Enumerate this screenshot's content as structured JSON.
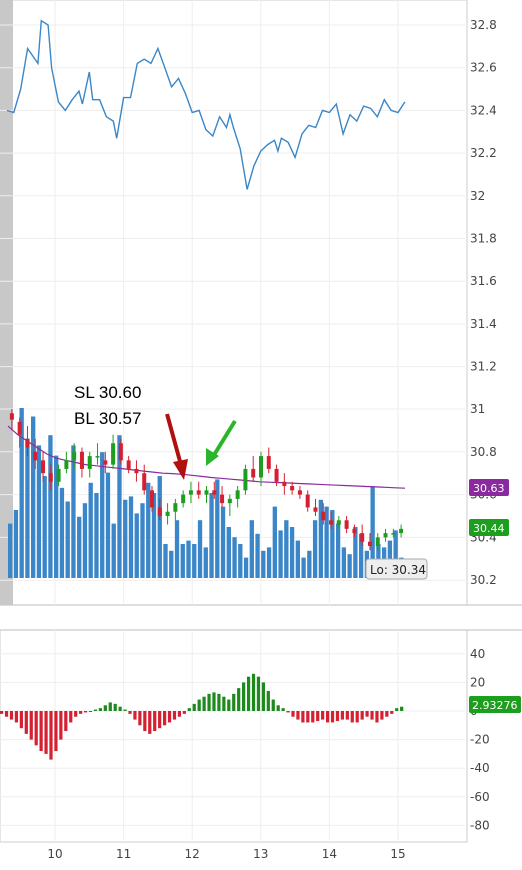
{
  "chart_data": [
    {
      "type": "line",
      "panel": "upper",
      "title": "",
      "xlabel": "",
      "ylabel": "",
      "ylim": [
        32.0,
        32.9
      ],
      "grid": true,
      "color": "#3a86c8",
      "x_ticks": [
        "10",
        "11",
        "12",
        "13",
        "14",
        "15"
      ],
      "y_ticks": [
        "32.8",
        "32.6",
        "32.4",
        "32.2",
        "32"
      ],
      "series": [
        {
          "x": [
            9.3,
            9.4,
            9.5,
            9.6,
            9.75,
            9.8,
            9.9,
            9.95,
            10.05,
            10.15,
            10.25,
            10.35,
            10.4,
            10.5,
            10.55,
            10.65,
            10.75,
            10.85,
            10.9,
            11.0,
            11.1,
            11.2,
            11.3,
            11.4,
            11.5,
            11.6,
            11.7,
            11.8,
            11.9,
            12.0,
            12.1,
            12.2,
            12.3,
            12.4,
            12.5,
            12.55,
            12.6,
            12.7,
            12.8,
            12.9,
            13.0,
            13.1,
            13.2,
            13.25,
            13.3,
            13.4,
            13.5,
            13.6,
            13.7,
            13.8,
            13.9,
            14.0,
            14.1,
            14.2,
            14.3,
            14.4,
            14.5,
            14.6,
            14.7,
            14.8,
            14.9,
            15.0,
            15.1
          ],
          "y": [
            32.4,
            32.39,
            32.5,
            32.69,
            32.62,
            32.82,
            32.8,
            32.6,
            32.44,
            32.4,
            32.45,
            32.49,
            32.43,
            32.58,
            32.45,
            32.45,
            32.37,
            32.35,
            32.27,
            32.46,
            32.46,
            32.62,
            32.64,
            32.62,
            32.69,
            32.6,
            32.51,
            32.55,
            32.48,
            32.39,
            32.4,
            32.31,
            32.28,
            32.37,
            32.32,
            32.38,
            32.32,
            32.22,
            32.03,
            32.14,
            32.21,
            32.24,
            32.26,
            32.21,
            32.27,
            32.25,
            32.18,
            32.29,
            32.33,
            32.32,
            32.4,
            32.39,
            32.43,
            32.29,
            32.38,
            32.35,
            32.42,
            32.41,
            32.37,
            32.45,
            32.4,
            32.39,
            32.44
          ]
        }
      ]
    },
    {
      "type": "candlestick",
      "panel": "upper",
      "y_ticks": [
        "31",
        "30.8",
        "30.6",
        "30.4",
        "30.2"
      ],
      "ylim": [
        30.1,
        31.0
      ],
      "up_color": "#1e9e1e",
      "down_color": "#d42030",
      "ohlc": [
        [
          30.98,
          31.0,
          30.9,
          30.95
        ],
        [
          30.94,
          30.96,
          30.82,
          30.88
        ],
        [
          30.86,
          30.92,
          30.78,
          30.82
        ],
        [
          30.8,
          30.86,
          30.72,
          30.76
        ],
        [
          30.76,
          30.8,
          30.66,
          30.7
        ],
        [
          30.7,
          30.74,
          30.62,
          30.66
        ],
        [
          30.66,
          30.74,
          30.64,
          30.72
        ],
        [
          30.72,
          30.8,
          30.7,
          30.76
        ],
        [
          30.76,
          30.84,
          30.72,
          30.8
        ],
        [
          30.8,
          30.82,
          30.68,
          30.72
        ],
        [
          30.72,
          30.8,
          30.68,
          30.78
        ],
        [
          30.78,
          30.84,
          30.74,
          30.78
        ],
        [
          30.76,
          30.8,
          30.7,
          30.74
        ],
        [
          30.74,
          30.88,
          30.72,
          30.84
        ],
        [
          30.84,
          30.86,
          30.74,
          30.76
        ],
        [
          30.76,
          30.78,
          30.7,
          30.72
        ],
        [
          30.72,
          30.76,
          30.66,
          30.7
        ],
        [
          30.7,
          30.74,
          30.6,
          30.62
        ],
        [
          30.62,
          30.64,
          30.52,
          30.54
        ],
        [
          30.54,
          30.58,
          30.48,
          30.5
        ],
        [
          30.5,
          30.56,
          30.46,
          30.52
        ],
        [
          30.52,
          30.58,
          30.48,
          30.56
        ],
        [
          30.56,
          30.62,
          30.54,
          30.6
        ],
        [
          30.6,
          30.66,
          30.56,
          30.62
        ],
        [
          30.62,
          30.66,
          30.58,
          30.6
        ],
        [
          30.6,
          30.64,
          30.56,
          30.62
        ],
        [
          30.62,
          30.66,
          30.58,
          30.6
        ],
        [
          30.6,
          30.64,
          30.54,
          30.56
        ],
        [
          30.56,
          30.6,
          30.5,
          30.58
        ],
        [
          30.58,
          30.64,
          30.54,
          30.62
        ],
        [
          30.62,
          30.74,
          30.6,
          30.72
        ],
        [
          30.72,
          30.78,
          30.66,
          30.68
        ],
        [
          30.68,
          30.8,
          30.64,
          30.78
        ],
        [
          30.78,
          30.82,
          30.7,
          30.72
        ],
        [
          30.72,
          30.74,
          30.64,
          30.66
        ],
        [
          30.66,
          30.7,
          30.6,
          30.64
        ],
        [
          30.64,
          30.66,
          30.6,
          30.62
        ],
        [
          30.62,
          30.64,
          30.58,
          30.6
        ],
        [
          30.6,
          30.62,
          30.52,
          30.54
        ],
        [
          30.54,
          30.58,
          30.5,
          30.52
        ],
        [
          30.52,
          30.56,
          30.46,
          30.48
        ],
        [
          30.48,
          30.52,
          30.44,
          30.46
        ],
        [
          30.46,
          30.5,
          30.44,
          30.48
        ],
        [
          30.48,
          30.5,
          30.42,
          30.44
        ],
        [
          30.44,
          30.46,
          30.4,
          30.42
        ],
        [
          30.42,
          30.46,
          30.36,
          30.38
        ],
        [
          30.38,
          30.42,
          30.34,
          30.36
        ],
        [
          30.36,
          30.42,
          30.34,
          30.4
        ],
        [
          30.4,
          30.44,
          30.38,
          30.42
        ],
        [
          30.42,
          30.44,
          30.4,
          30.42
        ],
        [
          30.42,
          30.46,
          30.4,
          30.44
        ]
      ]
    },
    {
      "type": "line",
      "panel": "upper",
      "series_role": "moving-average",
      "color": "#8a2a9e",
      "y": [
        30.92,
        30.88,
        30.85,
        30.82,
        30.79,
        30.77,
        30.76,
        30.75,
        30.74,
        30.735,
        30.73,
        30.725,
        30.72,
        30.715,
        30.71,
        30.705,
        30.7,
        30.698,
        30.695,
        30.69,
        30.685,
        30.68,
        30.676,
        30.672,
        30.668,
        30.664,
        30.66,
        30.658,
        30.656,
        30.654,
        30.652,
        30.65,
        30.648,
        30.646,
        30.644,
        30.642,
        30.64,
        30.638,
        30.636,
        30.634,
        30.632,
        30.63
      ]
    },
    {
      "type": "bar",
      "panel": "upper",
      "series_role": "volume",
      "color": "#3a86c8",
      "values": [
        0.32,
        0.4,
        1.0,
        0.82,
        0.95,
        0.78,
        0.6,
        0.84,
        0.72,
        0.53,
        0.45,
        0.78,
        0.36,
        0.44,
        0.56,
        0.5,
        0.74,
        0.62,
        0.32,
        0.84,
        0.46,
        0.48,
        0.38,
        0.44,
        0.56,
        0.5,
        0.6,
        0.2,
        0.16,
        0.34,
        0.2,
        0.22,
        0.2,
        0.34,
        0.18,
        0.5,
        0.58,
        0.42,
        0.3,
        0.24,
        0.2,
        0.12,
        0.34,
        0.26,
        0.16,
        0.18,
        0.42,
        0.28,
        0.34,
        0.3,
        0.22,
        0.12,
        0.16,
        0.34,
        0.46,
        0.42,
        0.4,
        0.32,
        0.18,
        0.14,
        0.3,
        0.26,
        0.16,
        0.54,
        0.2,
        0.18,
        0.22,
        0.28,
        0.12
      ]
    },
    {
      "type": "bar",
      "panel": "lower",
      "series_role": "oscillator",
      "y_ticks": [
        "40",
        "20",
        "0",
        "-20",
        "-40",
        "-60",
        "-80"
      ],
      "ylim": [
        -85,
        45
      ],
      "pos_color": "#1e8a1e",
      "neg_color": "#d42030",
      "values": [
        -2,
        -4,
        -6,
        -8,
        -12,
        -16,
        -20,
        -24,
        -28,
        -30,
        -34,
        -28,
        -20,
        -14,
        -8,
        -4,
        -2,
        -1,
        0,
        1,
        2,
        4,
        6,
        5,
        3,
        1,
        -2,
        -6,
        -10,
        -14,
        -16,
        -14,
        -12,
        -10,
        -8,
        -6,
        -4,
        -2,
        2,
        5,
        8,
        10,
        12,
        13,
        12,
        10,
        8,
        12,
        16,
        20,
        24,
        26,
        24,
        20,
        14,
        8,
        4,
        2,
        -1,
        -4,
        -6,
        -8,
        -8,
        -8,
        -7,
        -6,
        -8,
        -8,
        -7,
        -6,
        -6,
        -8,
        -8,
        -6,
        -4,
        -6,
        -8,
        -6,
        -4,
        -2,
        2,
        3
      ]
    }
  ],
  "annotations": {
    "sl_text": "SL 30.60",
    "bl_text": "BL 30.57",
    "lo_tag": "Lo: 30.34",
    "ma_tag": "30.63",
    "price_tag": "30.44",
    "osc_tag": "2.93276",
    "red_arrow_color": "#b01010",
    "green_arrow_color": "#2ab52a",
    "ma_tag_color": "#8a2a9e",
    "price_tag_color": "#1e9e1e",
    "osc_tag_color": "#1e9e1e"
  }
}
